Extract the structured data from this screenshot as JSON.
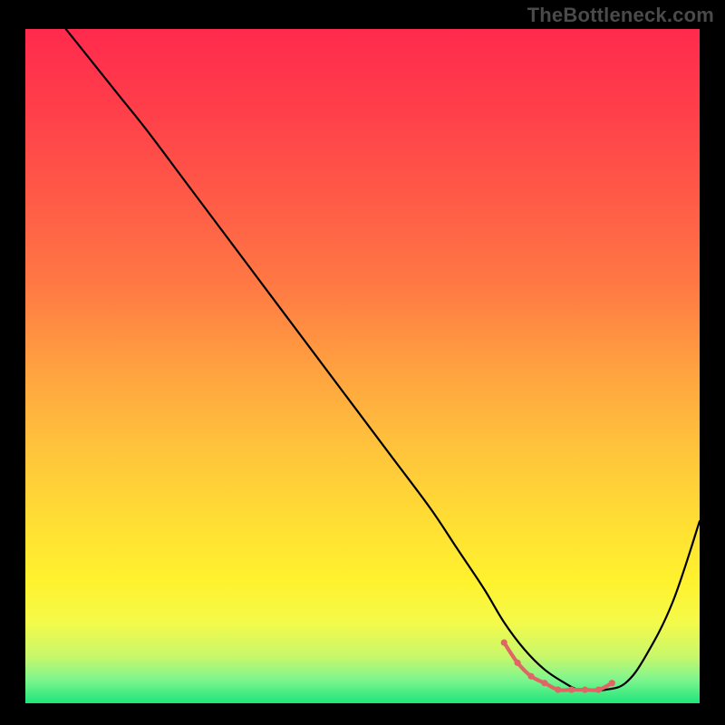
{
  "watermark": "TheBottleneck.com",
  "chart_data": {
    "type": "line",
    "title": "",
    "xlabel": "",
    "ylabel": "",
    "xlim": [
      0,
      100
    ],
    "ylim": [
      0,
      100
    ],
    "grid": false,
    "gradient_stops": [
      {
        "offset": 0.0,
        "color": "#ff2a4d"
      },
      {
        "offset": 0.12,
        "color": "#ff3f4a"
      },
      {
        "offset": 0.25,
        "color": "#ff5a47"
      },
      {
        "offset": 0.38,
        "color": "#ff7944"
      },
      {
        "offset": 0.5,
        "color": "#ffa040"
      },
      {
        "offset": 0.62,
        "color": "#ffc33c"
      },
      {
        "offset": 0.74,
        "color": "#ffe033"
      },
      {
        "offset": 0.82,
        "color": "#fff22e"
      },
      {
        "offset": 0.88,
        "color": "#f4fa4a"
      },
      {
        "offset": 0.93,
        "color": "#c9f76a"
      },
      {
        "offset": 0.965,
        "color": "#7ef58e"
      },
      {
        "offset": 1.0,
        "color": "#1fe57a"
      }
    ],
    "series": [
      {
        "name": "curve",
        "stroke": "#000000",
        "stroke_width": 2.2,
        "x": [
          6,
          10,
          14,
          18,
          24,
          30,
          36,
          42,
          48,
          54,
          60,
          64,
          68,
          71,
          74,
          77,
          80,
          82,
          84,
          86,
          89,
          92,
          96,
          100
        ],
        "y": [
          100,
          95,
          90,
          85,
          77,
          69,
          61,
          53,
          45,
          37,
          29,
          23,
          17,
          12,
          8,
          5,
          3,
          2,
          2,
          2,
          3,
          7,
          15,
          27
        ]
      },
      {
        "name": "optimal-markers",
        "stroke": "#e06666",
        "stroke_width": 4.2,
        "marker_radius": 3.6,
        "marker_fill": "#e06666",
        "x": [
          71,
          73,
          75,
          77,
          79,
          81,
          83,
          85,
          87
        ],
        "y": [
          9,
          6,
          4,
          3,
          2,
          2,
          2,
          2,
          3
        ]
      }
    ],
    "colors": {
      "curve": "#000000",
      "markers": "#e06666",
      "background_frame": "#000000"
    }
  }
}
